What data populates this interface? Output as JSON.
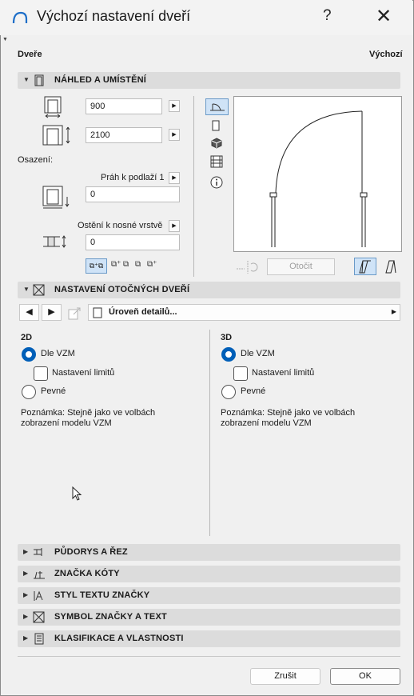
{
  "window": {
    "title": "Výchozí nastavení dveří",
    "help_glyph": "?",
    "close_glyph": "✕"
  },
  "header": {
    "left": "Dveře",
    "right": "Výchozí"
  },
  "sections": {
    "preview": "NÁHLED A UMÍSTĚNÍ",
    "swing": "NASTAVENÍ OTOČNÝCH DVEŘÍ",
    "floorplan": "PŮDORYS A ŘEZ",
    "dim_marker": "ZNAČKA KÓTY",
    "marker_text": "STYL TEXTU ZNAČKY",
    "marker_symbol": "SYMBOL ZNAČKY A TEXT",
    "classification": "KLASIFIKACE A VLASTNOSTI"
  },
  "placement": {
    "width": "900",
    "height": "2100",
    "osazeni_label": "Osazení:",
    "sill_ref": "Práh k podlaží 1",
    "sill_value": "0",
    "reveal_ref": "Ostění k nosné vrstvě",
    "reveal_value": "0",
    "rotate_label": "Otočit"
  },
  "swing_toolbar": {
    "detail_label": "Úroveň detailů..."
  },
  "panel_2d": {
    "heading": "2D",
    "opt_model": "Dle VZM",
    "check_limits": "Nastavení limitů",
    "opt_fixed": "Pevné",
    "note": [
      "Poznámka: Stejně jako ve volbách",
      "zobrazení modelu VZM"
    ]
  },
  "panel_3d": {
    "heading": "3D",
    "opt_model": "Dle VZM",
    "check_limits": "Nastavení limitů",
    "opt_fixed": "Pevné",
    "note": [
      "Poznámka: Stejně jako ve volbách",
      "zobrazení modelu VZM"
    ]
  },
  "footer": {
    "cancel": "Zrušit",
    "ok": "OK"
  },
  "colors": {
    "accent": "#005fb8",
    "section_bg": "#dcdcdc",
    "selected_tool": "#cfe3f7"
  }
}
